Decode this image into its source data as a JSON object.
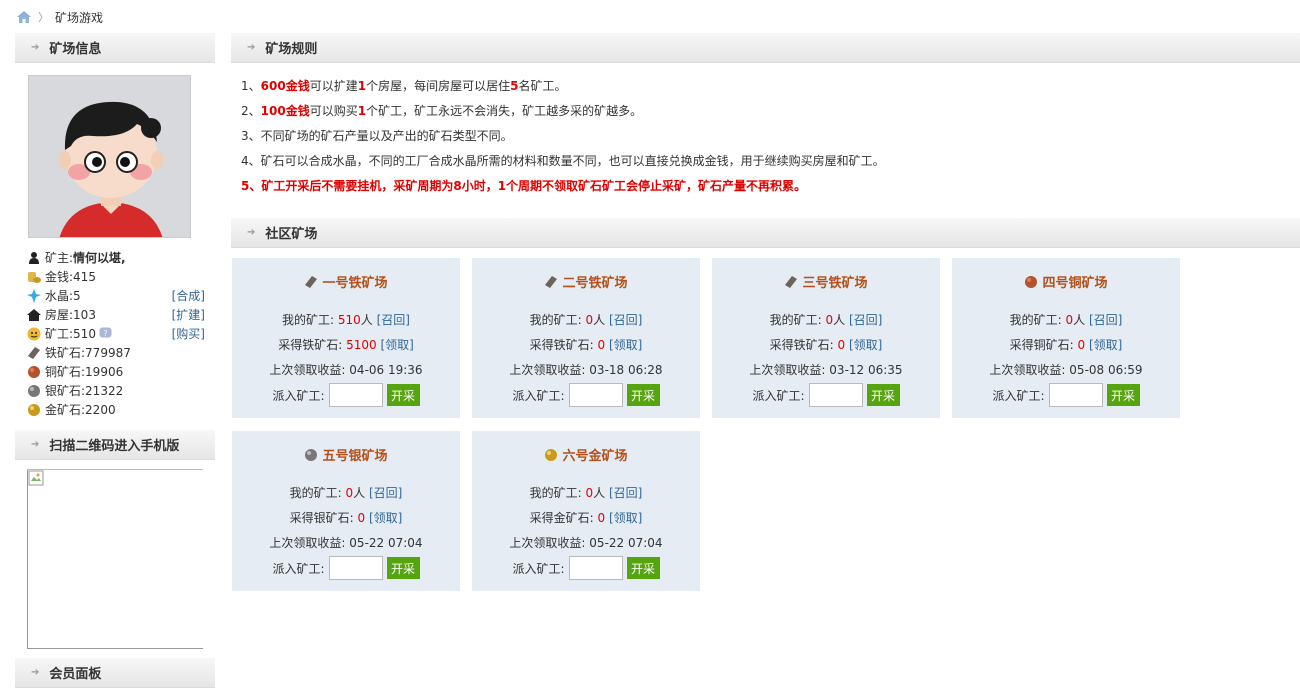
{
  "breadcrumb": {
    "current": "矿场游戏"
  },
  "sidebar": {
    "mine_info_title": "矿场信息",
    "owner_label": "矿主:",
    "owner_name": "情何以堪,",
    "stats": [
      {
        "label": "金钱:",
        "value": "415",
        "action": "",
        "icon": "coins-icon"
      },
      {
        "label": "水晶:",
        "value": "5",
        "action": "[合成]",
        "icon": "crystal-icon"
      },
      {
        "label": "房屋:",
        "value": "103",
        "action": "[扩建]",
        "icon": "house-icon"
      },
      {
        "label": "矿工:",
        "value": "510",
        "action": "[购买]",
        "icon": "miner-icon"
      },
      {
        "label": "铁矿石:",
        "value": "779987",
        "action": "",
        "icon": "iron-ore-icon"
      },
      {
        "label": "铜矿石:",
        "value": "19906",
        "action": "",
        "icon": "copper-ore-icon"
      },
      {
        "label": "银矿石:",
        "value": "21322",
        "action": "",
        "icon": "silver-ore-icon"
      },
      {
        "label": "金矿石:",
        "value": "2200",
        "action": "",
        "icon": "gold-ore-icon"
      }
    ],
    "qr_title": "扫描二维码进入手机版",
    "member_title": "会员面板"
  },
  "rules_title": "矿场规则",
  "rules": [
    {
      "prefix": "1、",
      "parts": [
        {
          "t": "600金钱",
          "red": true
        },
        {
          "t": "可以扩建"
        },
        {
          "t": "1",
          "red": true
        },
        {
          "t": "个房屋，每间房屋可以居住"
        },
        {
          "t": "5",
          "red": true
        },
        {
          "t": "名矿工。"
        }
      ]
    },
    {
      "prefix": "2、",
      "parts": [
        {
          "t": "100金钱",
          "red": true
        },
        {
          "t": "可以购买"
        },
        {
          "t": "1",
          "red": true
        },
        {
          "t": "个矿工，矿工永远不会消失，矿工越多采的矿越多。"
        }
      ]
    },
    {
      "prefix": "3、",
      "parts": [
        {
          "t": "不同矿场的矿石产量以及产出的矿石类型不同。"
        }
      ]
    },
    {
      "prefix": "4、",
      "parts": [
        {
          "t": "矿石可以合成水晶，不同的工厂合成水晶所需的材料和数量不同，也可以直接兑换成金钱，用于继续购买房屋和矿工。"
        }
      ]
    },
    {
      "prefix": "5、",
      "allRed": true,
      "parts": [
        {
          "t": "矿工开采后不需要挂机，采矿周期为8小时，1个周期不领取矿石矿工会停止采矿，矿石产量不再积累。"
        }
      ]
    }
  ],
  "mines_title": "社区矿场",
  "labels": {
    "my_miners": "我的矿工:",
    "people": "人",
    "recall": "[召回]",
    "claim": "[领取]",
    "last_claim": "上次领取收益:",
    "dispatch": "派入矿工:",
    "start": "开采"
  },
  "mines": [
    {
      "name": "一号铁矿场",
      "ore": "iron",
      "miners": "510",
      "ore_label": "采得铁矿石:",
      "ore_amount": "5100",
      "last": "04-06 19:36"
    },
    {
      "name": "二号铁矿场",
      "ore": "iron",
      "miners": "0",
      "ore_label": "采得铁矿石:",
      "ore_amount": "0",
      "last": "03-18 06:28"
    },
    {
      "name": "三号铁矿场",
      "ore": "iron",
      "miners": "0",
      "ore_label": "采得铁矿石:",
      "ore_amount": "0",
      "last": "03-12 06:35"
    },
    {
      "name": "四号铜矿场",
      "ore": "copper",
      "miners": "0",
      "ore_label": "采得铜矿石:",
      "ore_amount": "0",
      "last": "05-08 06:59"
    },
    {
      "name": "五号银矿场",
      "ore": "silver",
      "miners": "0",
      "ore_label": "采得银矿石:",
      "ore_amount": "0",
      "last": "05-22 07:04"
    },
    {
      "name": "六号金矿场",
      "ore": "gold",
      "miners": "0",
      "ore_label": "采得金矿石:",
      "ore_amount": "0",
      "last": "05-22 07:04"
    }
  ],
  "colors": {
    "accent_red": "#e10000",
    "link_blue": "#336699",
    "button_green": "#55a410",
    "mine_title": "#b3501c",
    "card_bg": "#e5ecf3"
  }
}
